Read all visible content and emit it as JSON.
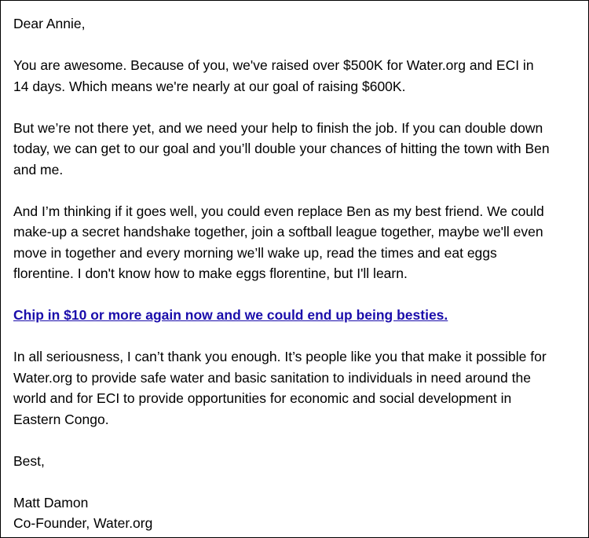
{
  "email": {
    "greeting": "Dear Annie,",
    "para1": [
      "You are awesome. Because of you, we've raised over $500K for Water.org and ECI in",
      "14 days. Which means we're nearly at our goal of raising $600K."
    ],
    "para2": [
      "But we’re not there yet, and we need your help to finish the job. If you can double down",
      "today, we can get to our goal and you’ll double your chances of hitting the town with Ben",
      "and me."
    ],
    "para3": [
      "And I’m thinking if it goes well, you could even replace Ben as my best friend. We could",
      "make-up a secret handshake together, join a softball league together, maybe we'll even",
      "move in together and every morning we’ll wake up, read the times and eat eggs",
      "florentine. I don't know how to make eggs florentine, but I'll learn."
    ],
    "cta_link": "Chip in $10 or more again now and we could end up being besties.",
    "para4": [
      "In all seriousness, I can’t thank you enough. It’s people like you that make it possible for",
      "Water.org to provide safe water and basic sanitation to individuals in need around the",
      "world and for ECI to provide opportunities for economic and social development in",
      "Eastern Congo."
    ],
    "closing": "Best,",
    "signature_name": "Matt Damon",
    "signature_title": "Co-Founder, Water.org"
  },
  "colors": {
    "link": "#1a0dab",
    "text": "#000000",
    "border": "#000000"
  }
}
